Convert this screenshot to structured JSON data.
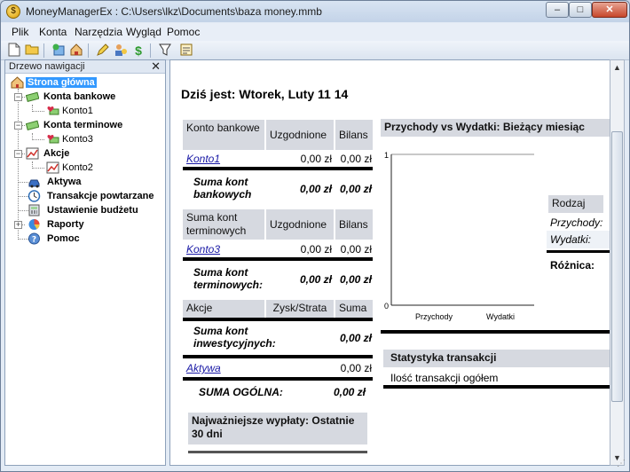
{
  "window": {
    "title": "MoneyManagerEx : C:\\Users\\lkz\\Documents\\baza money.mmb",
    "app_icon": "money-manager-icon",
    "minimize_glyph": "–",
    "maximize_glyph": "□",
    "close_glyph": "✕"
  },
  "menu": [
    "Plik",
    "Konta",
    "Narzędzia",
    "Wygląd",
    "Pomoc"
  ],
  "nav": {
    "header": "Drzewo nawigacji",
    "close_glyph": "✕",
    "items": [
      {
        "label": "Strona główna",
        "icon": "home-icon"
      },
      {
        "label": "Konta bankowe",
        "icon": "money-icon"
      },
      {
        "label": "Konto1",
        "icon": "heart-money-icon"
      },
      {
        "label": "Konta terminowe",
        "icon": "money-icon"
      },
      {
        "label": "Konto3",
        "icon": "heart-money-icon"
      },
      {
        "label": "Akcje",
        "icon": "chart-icon"
      },
      {
        "label": "Konto2",
        "icon": "chart-icon"
      },
      {
        "label": "Aktywa",
        "icon": "car-icon"
      },
      {
        "label": "Transakcje powtarzane",
        "icon": "clock-icon"
      },
      {
        "label": "Ustawienie budżetu",
        "icon": "calculator-icon"
      },
      {
        "label": "Raporty",
        "icon": "pie-chart-icon"
      },
      {
        "label": "Pomoc",
        "icon": "help-icon"
      }
    ]
  },
  "content": {
    "today": "Dziś jest:  Wtorek, Luty 11 14",
    "bank": {
      "h1": "Konto bankowe",
      "h2": "Uzgodnione",
      "h3": "Bilans",
      "row": {
        "name": "Konto1",
        "reconciled": "0,00 zł",
        "balance": "0,00 zł"
      },
      "sum_label": "Suma kont bankowych",
      "sum_reconciled": "0,00 zł",
      "sum_balance": "0,00 zł"
    },
    "term": {
      "h1": "Suma kont terminowych",
      "h2": "Uzgodnione",
      "h3": "Bilans",
      "row": {
        "name": "Konto3",
        "reconciled": "0,00 zł",
        "balance": "0,00 zł"
      },
      "sum_label": "Suma kont terminowych:",
      "sum_reconciled": "0,00 zł",
      "sum_balance": "0,00 zł"
    },
    "stocks": {
      "h1": "Akcje",
      "h2": "Zysk/Strata",
      "h3": "Suma",
      "sum_label": "Suma kont inwestycyjnych:",
      "sum_value": "0,00 zł"
    },
    "assets": {
      "name": "Aktywa",
      "value": "0,00 zł"
    },
    "total": {
      "label": "SUMA OGÓLNA:",
      "value": "0,00 zł"
    },
    "top_withdrawals": "Najważniejsze wypłaty: Ostatnie 30 dni",
    "income_vs": {
      "title": "Przychody vs Wydatki: Bieżący miesiąc",
      "header": "Rodzaj",
      "income_label": "Przychody:",
      "expense_label": "Wydatki:",
      "diff_label": "Różnica:"
    },
    "stats": {
      "title": "Statystyka transakcji",
      "count_label": "Ilość transakcji ogółem"
    }
  },
  "chart_data": {
    "type": "bar",
    "categories": [
      "Przychody",
      "Wydatki"
    ],
    "values": [
      0,
      0
    ],
    "ylim": [
      0,
      1
    ],
    "yticks": [
      "0",
      "1"
    ]
  }
}
